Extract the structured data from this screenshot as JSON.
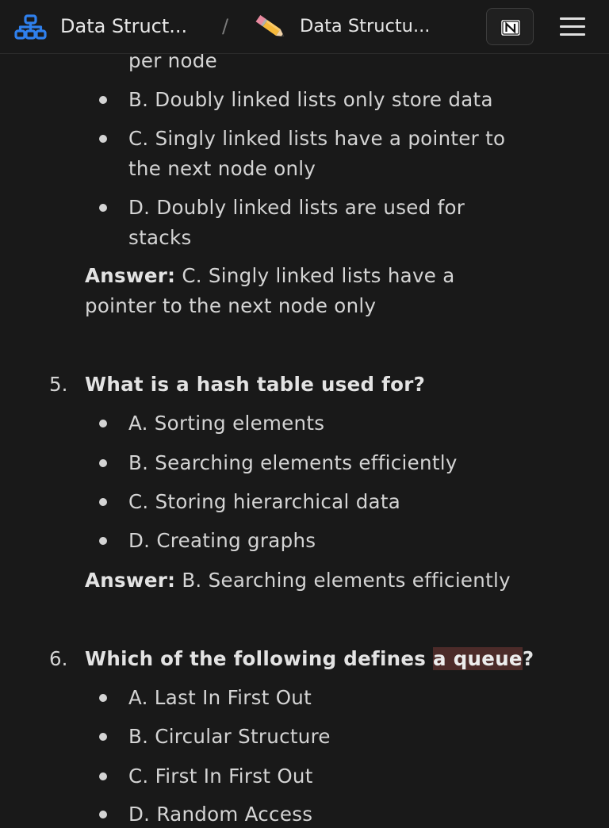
{
  "header": {
    "workspace_title": "Data Struct...",
    "separator": "/",
    "page_title": "Data Structu...",
    "workspace_icon": "hierarchy-icon",
    "page_icon": "pencil-emoji-icon",
    "notion_icon": "notion-logo-icon",
    "menu_icon": "hamburger-menu-icon"
  },
  "q4": {
    "cont_line": "per node",
    "options": [
      {
        "l1": "B. Doubly linked lists only store data"
      },
      {
        "l1": "C. Singly linked lists have a pointer to",
        "l2": "the next node only"
      },
      {
        "l1": "D. Doubly linked lists are used for",
        "l2": "stacks"
      }
    ],
    "answer_label": "Answer:",
    "answer_l1": "C. Singly linked lists have a",
    "answer_l2": "pointer to the next node only"
  },
  "q5": {
    "number": "5.",
    "question": "What is a hash table used for?",
    "options": [
      "A. Sorting elements",
      "B. Searching elements efficiently",
      "C. Storing hierarchical data",
      "D. Creating graphs"
    ],
    "answer_label": "Answer:",
    "answer": "B. Searching elements efficiently"
  },
  "q6": {
    "number": "6.",
    "question_pre": "Which of the following defines ",
    "question_highlight": "a queue",
    "question_post": "?",
    "options": [
      "A. Last In First Out",
      "B. Circular Structure",
      "C. First In First Out",
      "D. Random Access"
    ]
  },
  "colors": {
    "background": "#191919",
    "text": "#d4d4d4",
    "highlight": "#4c2b29",
    "icon_blue": "#2f80ed"
  }
}
